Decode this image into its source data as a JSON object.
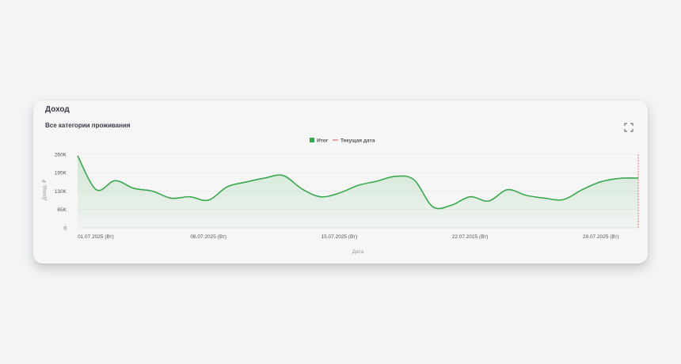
{
  "card": {
    "title": "Доход",
    "subtitle": "Все категории проживания",
    "expand_icon": "expand-icon"
  },
  "colors": {
    "line": "#3aa84e",
    "marker": "#e05050",
    "grid": "#e2e2e2"
  },
  "chart_data": {
    "type": "area",
    "xlabel": "Дата",
    "ylabel": "Доход, ₽",
    "ylim": [
      0,
      260000
    ],
    "y_ticks": [
      {
        "value": 0,
        "label": "0"
      },
      {
        "value": 65000,
        "label": "65K"
      },
      {
        "value": 130000,
        "label": "130K"
      },
      {
        "value": 195000,
        "label": "195K"
      },
      {
        "value": 260000,
        "label": "260K"
      }
    ],
    "x_ticks": [
      {
        "day": 1,
        "label": "01.07.2025 (Вт)"
      },
      {
        "day": 8,
        "label": "08.07.2025 (Вт)"
      },
      {
        "day": 15,
        "label": "15.07.2025 (Вт)"
      },
      {
        "day": 22,
        "label": "22.07.2025 (Вт)"
      },
      {
        "day": 29,
        "label": "29.07.2025 (Вт)"
      }
    ],
    "x_range": [
      1,
      31
    ],
    "legend": [
      "Итог",
      "Текущая дата"
    ],
    "series": [
      {
        "name": "Итог",
        "x": [
          "01.07.2025",
          "02.07.2025",
          "03.07.2025",
          "04.07.2025",
          "05.07.2025",
          "06.07.2025",
          "07.07.2025",
          "08.07.2025",
          "09.07.2025",
          "10.07.2025",
          "11.07.2025",
          "12.07.2025",
          "13.07.2025",
          "14.07.2025",
          "15.07.2025",
          "16.07.2025",
          "17.07.2025",
          "18.07.2025",
          "19.07.2025",
          "20.07.2025",
          "21.07.2025",
          "22.07.2025",
          "23.07.2025",
          "24.07.2025",
          "25.07.2025",
          "26.07.2025",
          "27.07.2025",
          "28.07.2025",
          "29.07.2025",
          "30.07.2025",
          "31.07.2025"
        ],
        "values": [
          255000,
          135000,
          167000,
          140000,
          130000,
          105000,
          110000,
          98000,
          145000,
          162000,
          176000,
          185000,
          138000,
          110000,
          123000,
          150000,
          165000,
          182000,
          170000,
          75000,
          80000,
          110000,
          95000,
          135000,
          115000,
          105000,
          100000,
          135000,
          163000,
          175000,
          176000
        ]
      }
    ],
    "current_date": "31.07.2025"
  }
}
